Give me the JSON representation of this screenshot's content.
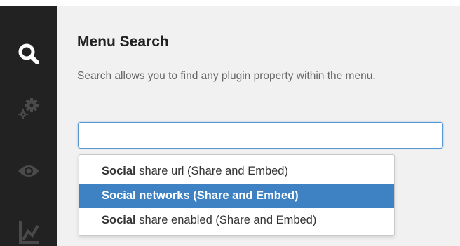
{
  "sidebar": {
    "icons": [
      "search-icon",
      "gears-icon",
      "eye-icon",
      "chart-icon"
    ],
    "icon_color_active": "#ffffff",
    "icon_color_inactive": "#4a4a4a"
  },
  "panel": {
    "title": "Menu Search",
    "description": "Search allows you to find any plugin property within the menu."
  },
  "search": {
    "value": "",
    "placeholder": ""
  },
  "suggestions": [
    {
      "match": "Social",
      "rest": " share url (Share and Embed)",
      "selected": false
    },
    {
      "match": "Social",
      "rest": " networks (Share and Embed)",
      "selected": true
    },
    {
      "match": "Social",
      "rest": " share enabled (Share and Embed)",
      "selected": false
    }
  ],
  "colors": {
    "sidebar_bg": "#222222",
    "content_bg": "#f1f1f1",
    "selected_bg": "#3e82c4",
    "input_border": "#5897d1"
  }
}
